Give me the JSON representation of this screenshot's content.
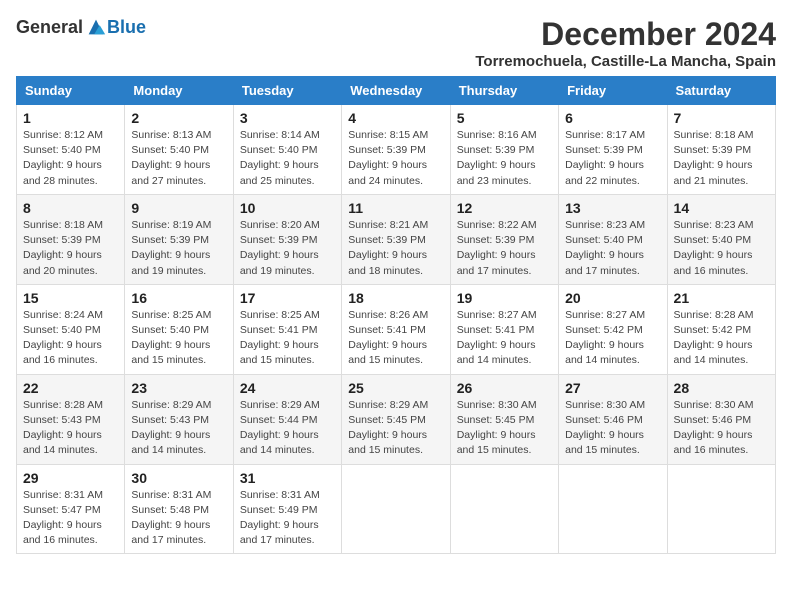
{
  "header": {
    "logo_general": "General",
    "logo_blue": "Blue",
    "title": "December 2024",
    "location": "Torremochuela, Castille-La Mancha, Spain"
  },
  "columns": [
    "Sunday",
    "Monday",
    "Tuesday",
    "Wednesday",
    "Thursday",
    "Friday",
    "Saturday"
  ],
  "weeks": [
    [
      {
        "day": "1",
        "lines": [
          "Sunrise: 8:12 AM",
          "Sunset: 5:40 PM",
          "Daylight: 9 hours",
          "and 28 minutes."
        ]
      },
      {
        "day": "2",
        "lines": [
          "Sunrise: 8:13 AM",
          "Sunset: 5:40 PM",
          "Daylight: 9 hours",
          "and 27 minutes."
        ]
      },
      {
        "day": "3",
        "lines": [
          "Sunrise: 8:14 AM",
          "Sunset: 5:40 PM",
          "Daylight: 9 hours",
          "and 25 minutes."
        ]
      },
      {
        "day": "4",
        "lines": [
          "Sunrise: 8:15 AM",
          "Sunset: 5:39 PM",
          "Daylight: 9 hours",
          "and 24 minutes."
        ]
      },
      {
        "day": "5",
        "lines": [
          "Sunrise: 8:16 AM",
          "Sunset: 5:39 PM",
          "Daylight: 9 hours",
          "and 23 minutes."
        ]
      },
      {
        "day": "6",
        "lines": [
          "Sunrise: 8:17 AM",
          "Sunset: 5:39 PM",
          "Daylight: 9 hours",
          "and 22 minutes."
        ]
      },
      {
        "day": "7",
        "lines": [
          "Sunrise: 8:18 AM",
          "Sunset: 5:39 PM",
          "Daylight: 9 hours",
          "and 21 minutes."
        ]
      }
    ],
    [
      {
        "day": "8",
        "lines": [
          "Sunrise: 8:18 AM",
          "Sunset: 5:39 PM",
          "Daylight: 9 hours",
          "and 20 minutes."
        ]
      },
      {
        "day": "9",
        "lines": [
          "Sunrise: 8:19 AM",
          "Sunset: 5:39 PM",
          "Daylight: 9 hours",
          "and 19 minutes."
        ]
      },
      {
        "day": "10",
        "lines": [
          "Sunrise: 8:20 AM",
          "Sunset: 5:39 PM",
          "Daylight: 9 hours",
          "and 19 minutes."
        ]
      },
      {
        "day": "11",
        "lines": [
          "Sunrise: 8:21 AM",
          "Sunset: 5:39 PM",
          "Daylight: 9 hours",
          "and 18 minutes."
        ]
      },
      {
        "day": "12",
        "lines": [
          "Sunrise: 8:22 AM",
          "Sunset: 5:39 PM",
          "Daylight: 9 hours",
          "and 17 minutes."
        ]
      },
      {
        "day": "13",
        "lines": [
          "Sunrise: 8:23 AM",
          "Sunset: 5:40 PM",
          "Daylight: 9 hours",
          "and 17 minutes."
        ]
      },
      {
        "day": "14",
        "lines": [
          "Sunrise: 8:23 AM",
          "Sunset: 5:40 PM",
          "Daylight: 9 hours",
          "and 16 minutes."
        ]
      }
    ],
    [
      {
        "day": "15",
        "lines": [
          "Sunrise: 8:24 AM",
          "Sunset: 5:40 PM",
          "Daylight: 9 hours",
          "and 16 minutes."
        ]
      },
      {
        "day": "16",
        "lines": [
          "Sunrise: 8:25 AM",
          "Sunset: 5:40 PM",
          "Daylight: 9 hours",
          "and 15 minutes."
        ]
      },
      {
        "day": "17",
        "lines": [
          "Sunrise: 8:25 AM",
          "Sunset: 5:41 PM",
          "Daylight: 9 hours",
          "and 15 minutes."
        ]
      },
      {
        "day": "18",
        "lines": [
          "Sunrise: 8:26 AM",
          "Sunset: 5:41 PM",
          "Daylight: 9 hours",
          "and 15 minutes."
        ]
      },
      {
        "day": "19",
        "lines": [
          "Sunrise: 8:27 AM",
          "Sunset: 5:41 PM",
          "Daylight: 9 hours",
          "and 14 minutes."
        ]
      },
      {
        "day": "20",
        "lines": [
          "Sunrise: 8:27 AM",
          "Sunset: 5:42 PM",
          "Daylight: 9 hours",
          "and 14 minutes."
        ]
      },
      {
        "day": "21",
        "lines": [
          "Sunrise: 8:28 AM",
          "Sunset: 5:42 PM",
          "Daylight: 9 hours",
          "and 14 minutes."
        ]
      }
    ],
    [
      {
        "day": "22",
        "lines": [
          "Sunrise: 8:28 AM",
          "Sunset: 5:43 PM",
          "Daylight: 9 hours",
          "and 14 minutes."
        ]
      },
      {
        "day": "23",
        "lines": [
          "Sunrise: 8:29 AM",
          "Sunset: 5:43 PM",
          "Daylight: 9 hours",
          "and 14 minutes."
        ]
      },
      {
        "day": "24",
        "lines": [
          "Sunrise: 8:29 AM",
          "Sunset: 5:44 PM",
          "Daylight: 9 hours",
          "and 14 minutes."
        ]
      },
      {
        "day": "25",
        "lines": [
          "Sunrise: 8:29 AM",
          "Sunset: 5:45 PM",
          "Daylight: 9 hours",
          "and 15 minutes."
        ]
      },
      {
        "day": "26",
        "lines": [
          "Sunrise: 8:30 AM",
          "Sunset: 5:45 PM",
          "Daylight: 9 hours",
          "and 15 minutes."
        ]
      },
      {
        "day": "27",
        "lines": [
          "Sunrise: 8:30 AM",
          "Sunset: 5:46 PM",
          "Daylight: 9 hours",
          "and 15 minutes."
        ]
      },
      {
        "day": "28",
        "lines": [
          "Sunrise: 8:30 AM",
          "Sunset: 5:46 PM",
          "Daylight: 9 hours",
          "and 16 minutes."
        ]
      }
    ],
    [
      {
        "day": "29",
        "lines": [
          "Sunrise: 8:31 AM",
          "Sunset: 5:47 PM",
          "Daylight: 9 hours",
          "and 16 minutes."
        ]
      },
      {
        "day": "30",
        "lines": [
          "Sunrise: 8:31 AM",
          "Sunset: 5:48 PM",
          "Daylight: 9 hours",
          "and 17 minutes."
        ]
      },
      {
        "day": "31",
        "lines": [
          "Sunrise: 8:31 AM",
          "Sunset: 5:49 PM",
          "Daylight: 9 hours",
          "and 17 minutes."
        ]
      },
      null,
      null,
      null,
      null
    ]
  ]
}
